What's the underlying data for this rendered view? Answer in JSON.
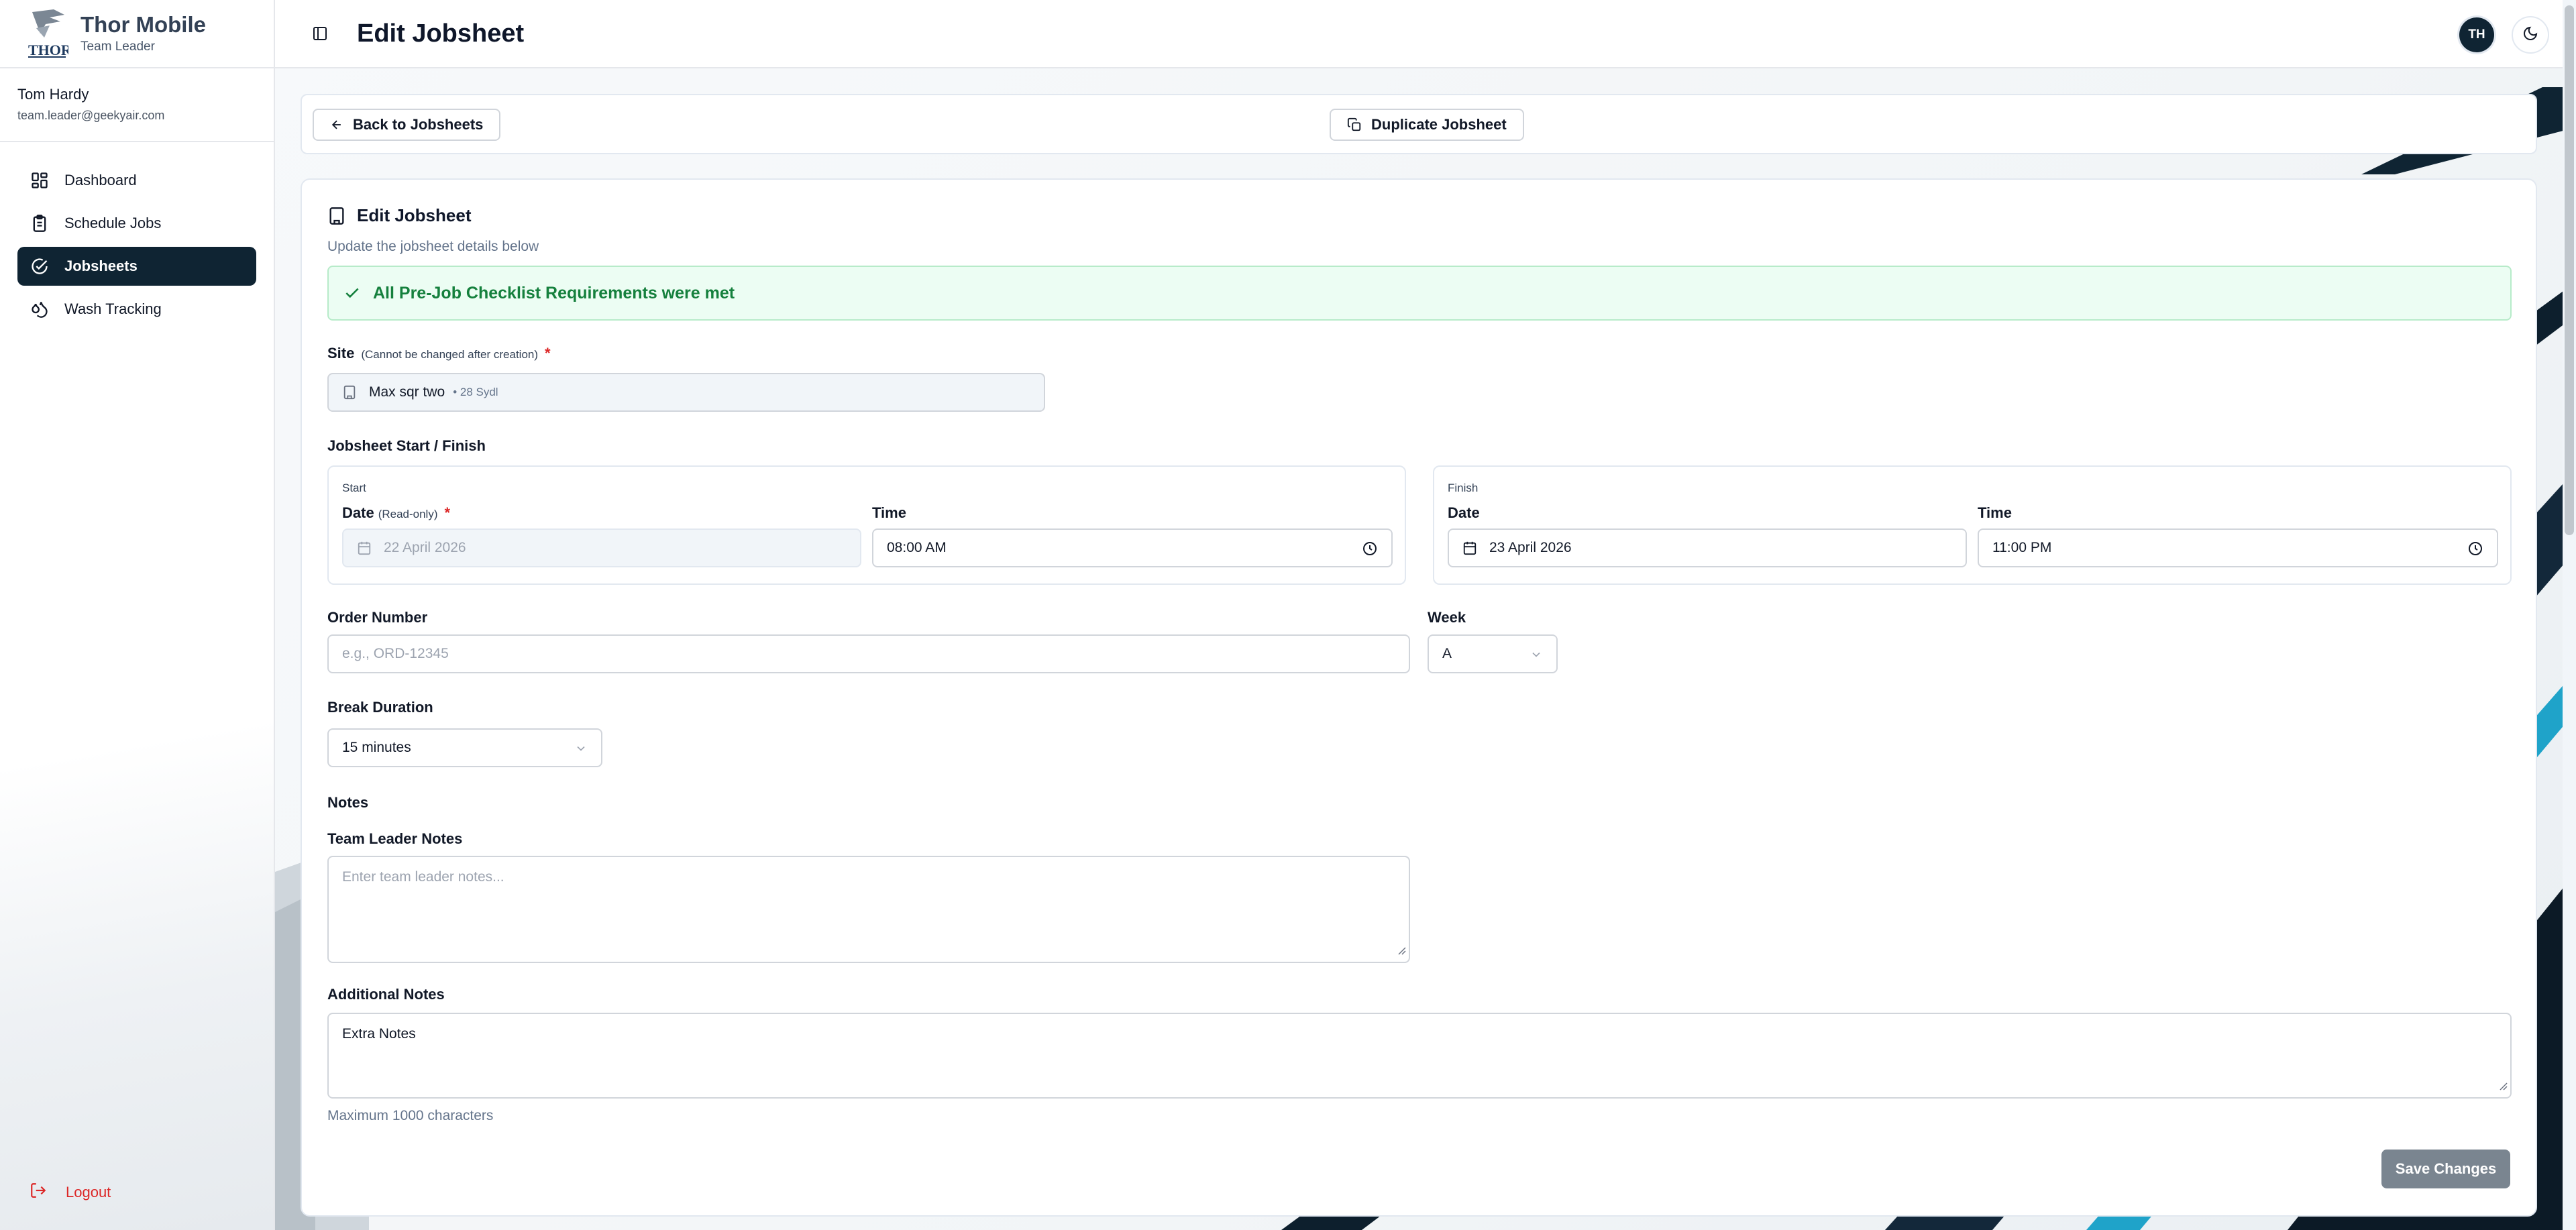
{
  "app": {
    "name": "Thor Mobile",
    "role": "Team Leader",
    "logo_text": "THOR"
  },
  "user": {
    "name": "Tom Hardy",
    "email": "team.leader@geekyair.com",
    "initials": "TH"
  },
  "sidebar": {
    "items": [
      {
        "label": "Dashboard",
        "icon": "dashboard-grid-icon",
        "active": false
      },
      {
        "label": "Schedule Jobs",
        "icon": "clipboard-icon",
        "active": false
      },
      {
        "label": "Jobsheets",
        "icon": "check-circle-icon",
        "active": true
      },
      {
        "label": "Wash Tracking",
        "icon": "droplets-icon",
        "active": false
      }
    ],
    "logout_label": "Logout"
  },
  "header": {
    "title": "Edit Jobsheet"
  },
  "actions": {
    "back_label": "Back to Jobsheets",
    "duplicate_label": "Duplicate Jobsheet"
  },
  "form": {
    "title": "Edit Jobsheet",
    "subtitle": "Update the jobsheet details below",
    "banner": "All Pre-Job Checklist Requirements were met",
    "site": {
      "label": "Site",
      "hint": "(Cannot be changed after creation)",
      "required_mark": "*",
      "value": "Max sqr two",
      "detail": "• 28 Sydl"
    },
    "schedule": {
      "label": "Jobsheet Start / Finish",
      "start": {
        "caption": "Start",
        "date_label": "Date",
        "date_hint": "(Read-only)",
        "required_mark": "*",
        "date_value": "22 April 2026",
        "time_label": "Time",
        "time_value": "08:00 AM"
      },
      "finish": {
        "caption": "Finish",
        "date_label": "Date",
        "date_value": "23 April 2026",
        "time_label": "Time",
        "time_value": "11:00 PM"
      }
    },
    "order_number": {
      "label": "Order Number",
      "placeholder": "e.g., ORD-12345",
      "value": ""
    },
    "week": {
      "label": "Week",
      "value": "A"
    },
    "break_duration": {
      "label": "Break Duration",
      "value": "15 minutes"
    },
    "notes": {
      "section_label": "Notes",
      "team_leader_label": "Team Leader Notes",
      "team_leader_placeholder": "Enter team leader notes...",
      "team_leader_value": "",
      "additional_label": "Additional Notes",
      "additional_value": "Extra Notes",
      "limit_hint": "Maximum 1000 characters"
    },
    "save_label": "Save Changes"
  },
  "colors": {
    "primary": "#0f2433",
    "success_bg": "#ecfdf3",
    "success_text": "#15803d",
    "danger": "#dc2626",
    "save_button": "#7a8590"
  }
}
